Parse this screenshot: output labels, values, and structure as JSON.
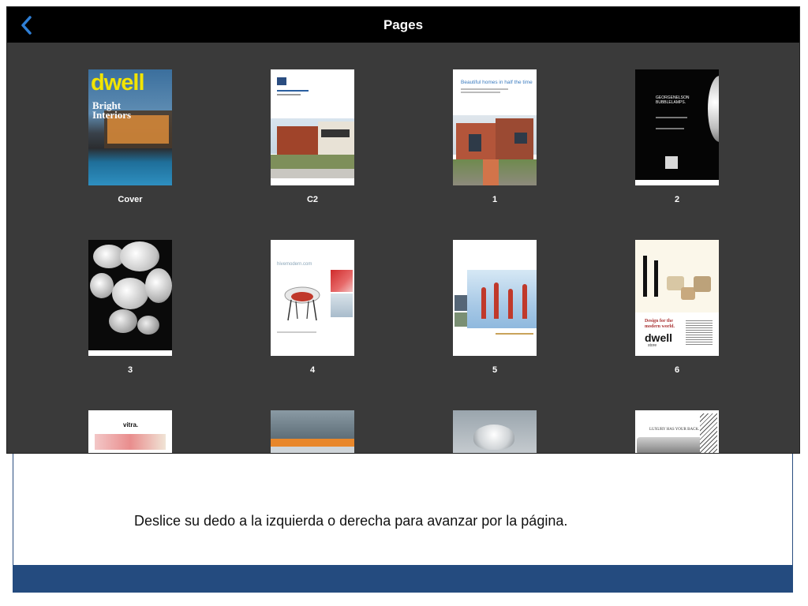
{
  "app": {
    "title": "Pages",
    "back_icon": "chevron-left-icon",
    "accent_color": "#2f7fd6"
  },
  "pages": [
    {
      "label": "Cover"
    },
    {
      "label": "C2"
    },
    {
      "label": "1"
    },
    {
      "label": "2"
    },
    {
      "label": "3"
    },
    {
      "label": "4"
    },
    {
      "label": "5"
    },
    {
      "label": "6"
    },
    {
      "label": ""
    },
    {
      "label": ""
    },
    {
      "label": ""
    },
    {
      "label": ""
    }
  ],
  "art": {
    "cover_logo": "dwell",
    "cover_heading_1": "Bright",
    "cover_heading_2": "Interiors",
    "p1_headline": "Beautiful homes in half the time",
    "p2_brand_line1": "GEORGENELSON",
    "p2_brand_line2": "BUBBLELAMPS.",
    "p4_url": "hivemodern.com",
    "p6_line1": "Design for the",
    "p6_line2": "modern world.",
    "p6_logo": "dwell",
    "p6_logo_sub": "store",
    "p7_logo": "vitra.",
    "p10_line": "LUXURY HAS YOUR BACK."
  },
  "slide": {
    "caption": "Deslice su dedo a la izquierda o derecha para avanzar por la página.",
    "band_color": "#244b7f"
  }
}
